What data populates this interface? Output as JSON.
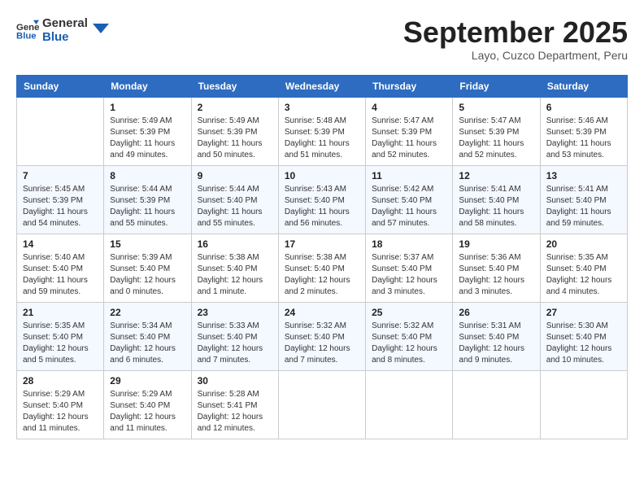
{
  "logo": {
    "line1": "General",
    "line2": "Blue"
  },
  "title": "September 2025",
  "subtitle": "Layo, Cuzco Department, Peru",
  "headers": [
    "Sunday",
    "Monday",
    "Tuesday",
    "Wednesday",
    "Thursday",
    "Friday",
    "Saturday"
  ],
  "weeks": [
    [
      {
        "day": "",
        "info": ""
      },
      {
        "day": "1",
        "info": "Sunrise: 5:49 AM\nSunset: 5:39 PM\nDaylight: 11 hours\nand 49 minutes."
      },
      {
        "day": "2",
        "info": "Sunrise: 5:49 AM\nSunset: 5:39 PM\nDaylight: 11 hours\nand 50 minutes."
      },
      {
        "day": "3",
        "info": "Sunrise: 5:48 AM\nSunset: 5:39 PM\nDaylight: 11 hours\nand 51 minutes."
      },
      {
        "day": "4",
        "info": "Sunrise: 5:47 AM\nSunset: 5:39 PM\nDaylight: 11 hours\nand 52 minutes."
      },
      {
        "day": "5",
        "info": "Sunrise: 5:47 AM\nSunset: 5:39 PM\nDaylight: 11 hours\nand 52 minutes."
      },
      {
        "day": "6",
        "info": "Sunrise: 5:46 AM\nSunset: 5:39 PM\nDaylight: 11 hours\nand 53 minutes."
      }
    ],
    [
      {
        "day": "7",
        "info": "Sunrise: 5:45 AM\nSunset: 5:39 PM\nDaylight: 11 hours\nand 54 minutes."
      },
      {
        "day": "8",
        "info": "Sunrise: 5:44 AM\nSunset: 5:39 PM\nDaylight: 11 hours\nand 55 minutes."
      },
      {
        "day": "9",
        "info": "Sunrise: 5:44 AM\nSunset: 5:40 PM\nDaylight: 11 hours\nand 55 minutes."
      },
      {
        "day": "10",
        "info": "Sunrise: 5:43 AM\nSunset: 5:40 PM\nDaylight: 11 hours\nand 56 minutes."
      },
      {
        "day": "11",
        "info": "Sunrise: 5:42 AM\nSunset: 5:40 PM\nDaylight: 11 hours\nand 57 minutes."
      },
      {
        "day": "12",
        "info": "Sunrise: 5:41 AM\nSunset: 5:40 PM\nDaylight: 11 hours\nand 58 minutes."
      },
      {
        "day": "13",
        "info": "Sunrise: 5:41 AM\nSunset: 5:40 PM\nDaylight: 11 hours\nand 59 minutes."
      }
    ],
    [
      {
        "day": "14",
        "info": "Sunrise: 5:40 AM\nSunset: 5:40 PM\nDaylight: 11 hours\nand 59 minutes."
      },
      {
        "day": "15",
        "info": "Sunrise: 5:39 AM\nSunset: 5:40 PM\nDaylight: 12 hours\nand 0 minutes."
      },
      {
        "day": "16",
        "info": "Sunrise: 5:38 AM\nSunset: 5:40 PM\nDaylight: 12 hours\nand 1 minute."
      },
      {
        "day": "17",
        "info": "Sunrise: 5:38 AM\nSunset: 5:40 PM\nDaylight: 12 hours\nand 2 minutes."
      },
      {
        "day": "18",
        "info": "Sunrise: 5:37 AM\nSunset: 5:40 PM\nDaylight: 12 hours\nand 3 minutes."
      },
      {
        "day": "19",
        "info": "Sunrise: 5:36 AM\nSunset: 5:40 PM\nDaylight: 12 hours\nand 3 minutes."
      },
      {
        "day": "20",
        "info": "Sunrise: 5:35 AM\nSunset: 5:40 PM\nDaylight: 12 hours\nand 4 minutes."
      }
    ],
    [
      {
        "day": "21",
        "info": "Sunrise: 5:35 AM\nSunset: 5:40 PM\nDaylight: 12 hours\nand 5 minutes."
      },
      {
        "day": "22",
        "info": "Sunrise: 5:34 AM\nSunset: 5:40 PM\nDaylight: 12 hours\nand 6 minutes."
      },
      {
        "day": "23",
        "info": "Sunrise: 5:33 AM\nSunset: 5:40 PM\nDaylight: 12 hours\nand 7 minutes."
      },
      {
        "day": "24",
        "info": "Sunrise: 5:32 AM\nSunset: 5:40 PM\nDaylight: 12 hours\nand 7 minutes."
      },
      {
        "day": "25",
        "info": "Sunrise: 5:32 AM\nSunset: 5:40 PM\nDaylight: 12 hours\nand 8 minutes."
      },
      {
        "day": "26",
        "info": "Sunrise: 5:31 AM\nSunset: 5:40 PM\nDaylight: 12 hours\nand 9 minutes."
      },
      {
        "day": "27",
        "info": "Sunrise: 5:30 AM\nSunset: 5:40 PM\nDaylight: 12 hours\nand 10 minutes."
      }
    ],
    [
      {
        "day": "28",
        "info": "Sunrise: 5:29 AM\nSunset: 5:40 PM\nDaylight: 12 hours\nand 11 minutes."
      },
      {
        "day": "29",
        "info": "Sunrise: 5:29 AM\nSunset: 5:40 PM\nDaylight: 12 hours\nand 11 minutes."
      },
      {
        "day": "30",
        "info": "Sunrise: 5:28 AM\nSunset: 5:41 PM\nDaylight: 12 hours\nand 12 minutes."
      },
      {
        "day": "",
        "info": ""
      },
      {
        "day": "",
        "info": ""
      },
      {
        "day": "",
        "info": ""
      },
      {
        "day": "",
        "info": ""
      }
    ]
  ]
}
